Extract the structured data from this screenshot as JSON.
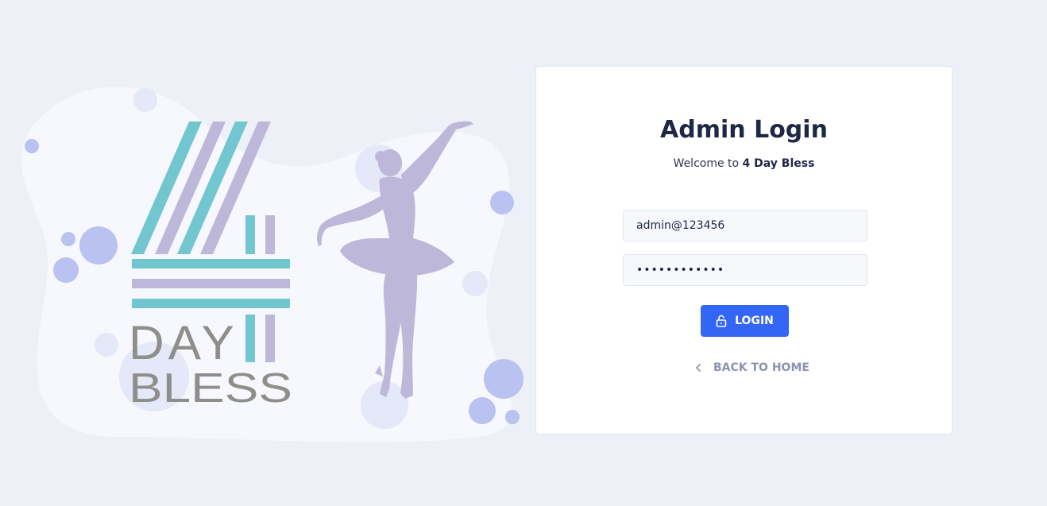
{
  "brand": {
    "logo_text_line1": "DAY",
    "logo_text_line2": "BLESS"
  },
  "login": {
    "title": "Admin Login",
    "welcome_prefix": "Welcome to",
    "welcome_brand": "4 Day Bless",
    "email_value": "admin@123456",
    "password_value": "••••••••••••",
    "login_button_label": "LOGIN",
    "back_link_label": "BACK TO HOME"
  },
  "icons": {
    "login_icon": "unlock-icon",
    "back_icon": "chevron-left-icon"
  },
  "colors": {
    "background": "#edf0f7",
    "primary": "#3466f6",
    "teal": "#72c6cf",
    "lavender": "#bdb8d9",
    "bubble": "#b9c2f0",
    "text_dark": "#1e2844",
    "text_muted": "#8c93ab"
  }
}
